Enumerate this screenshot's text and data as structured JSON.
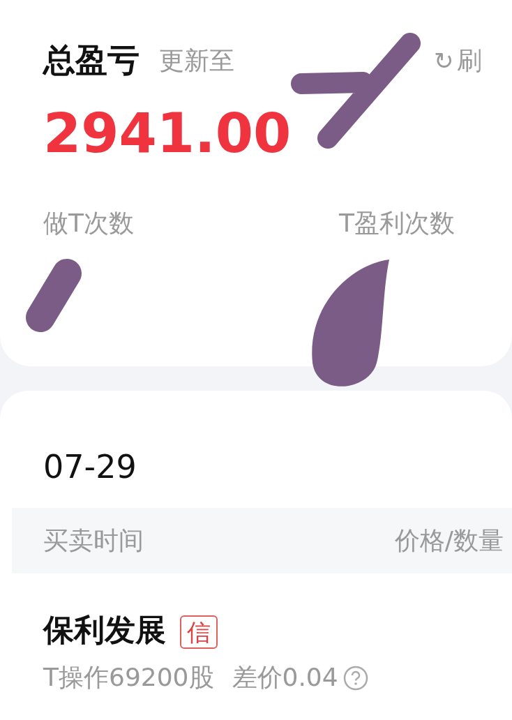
{
  "summary": {
    "title": "总盈亏",
    "updated_label": "更新至",
    "refresh": {
      "icon": "↻",
      "label": "刷"
    },
    "total": "2941.00",
    "stats": [
      {
        "label": "做T次数"
      },
      {
        "label": "T盈利次数"
      }
    ]
  },
  "records": {
    "date": "07-29",
    "columns": [
      "买卖时间",
      "价格/数量"
    ],
    "items": [
      {
        "name": "保利发展",
        "badge": "信",
        "detail": "T操作69200股",
        "spread": "差价0.04"
      }
    ]
  }
}
